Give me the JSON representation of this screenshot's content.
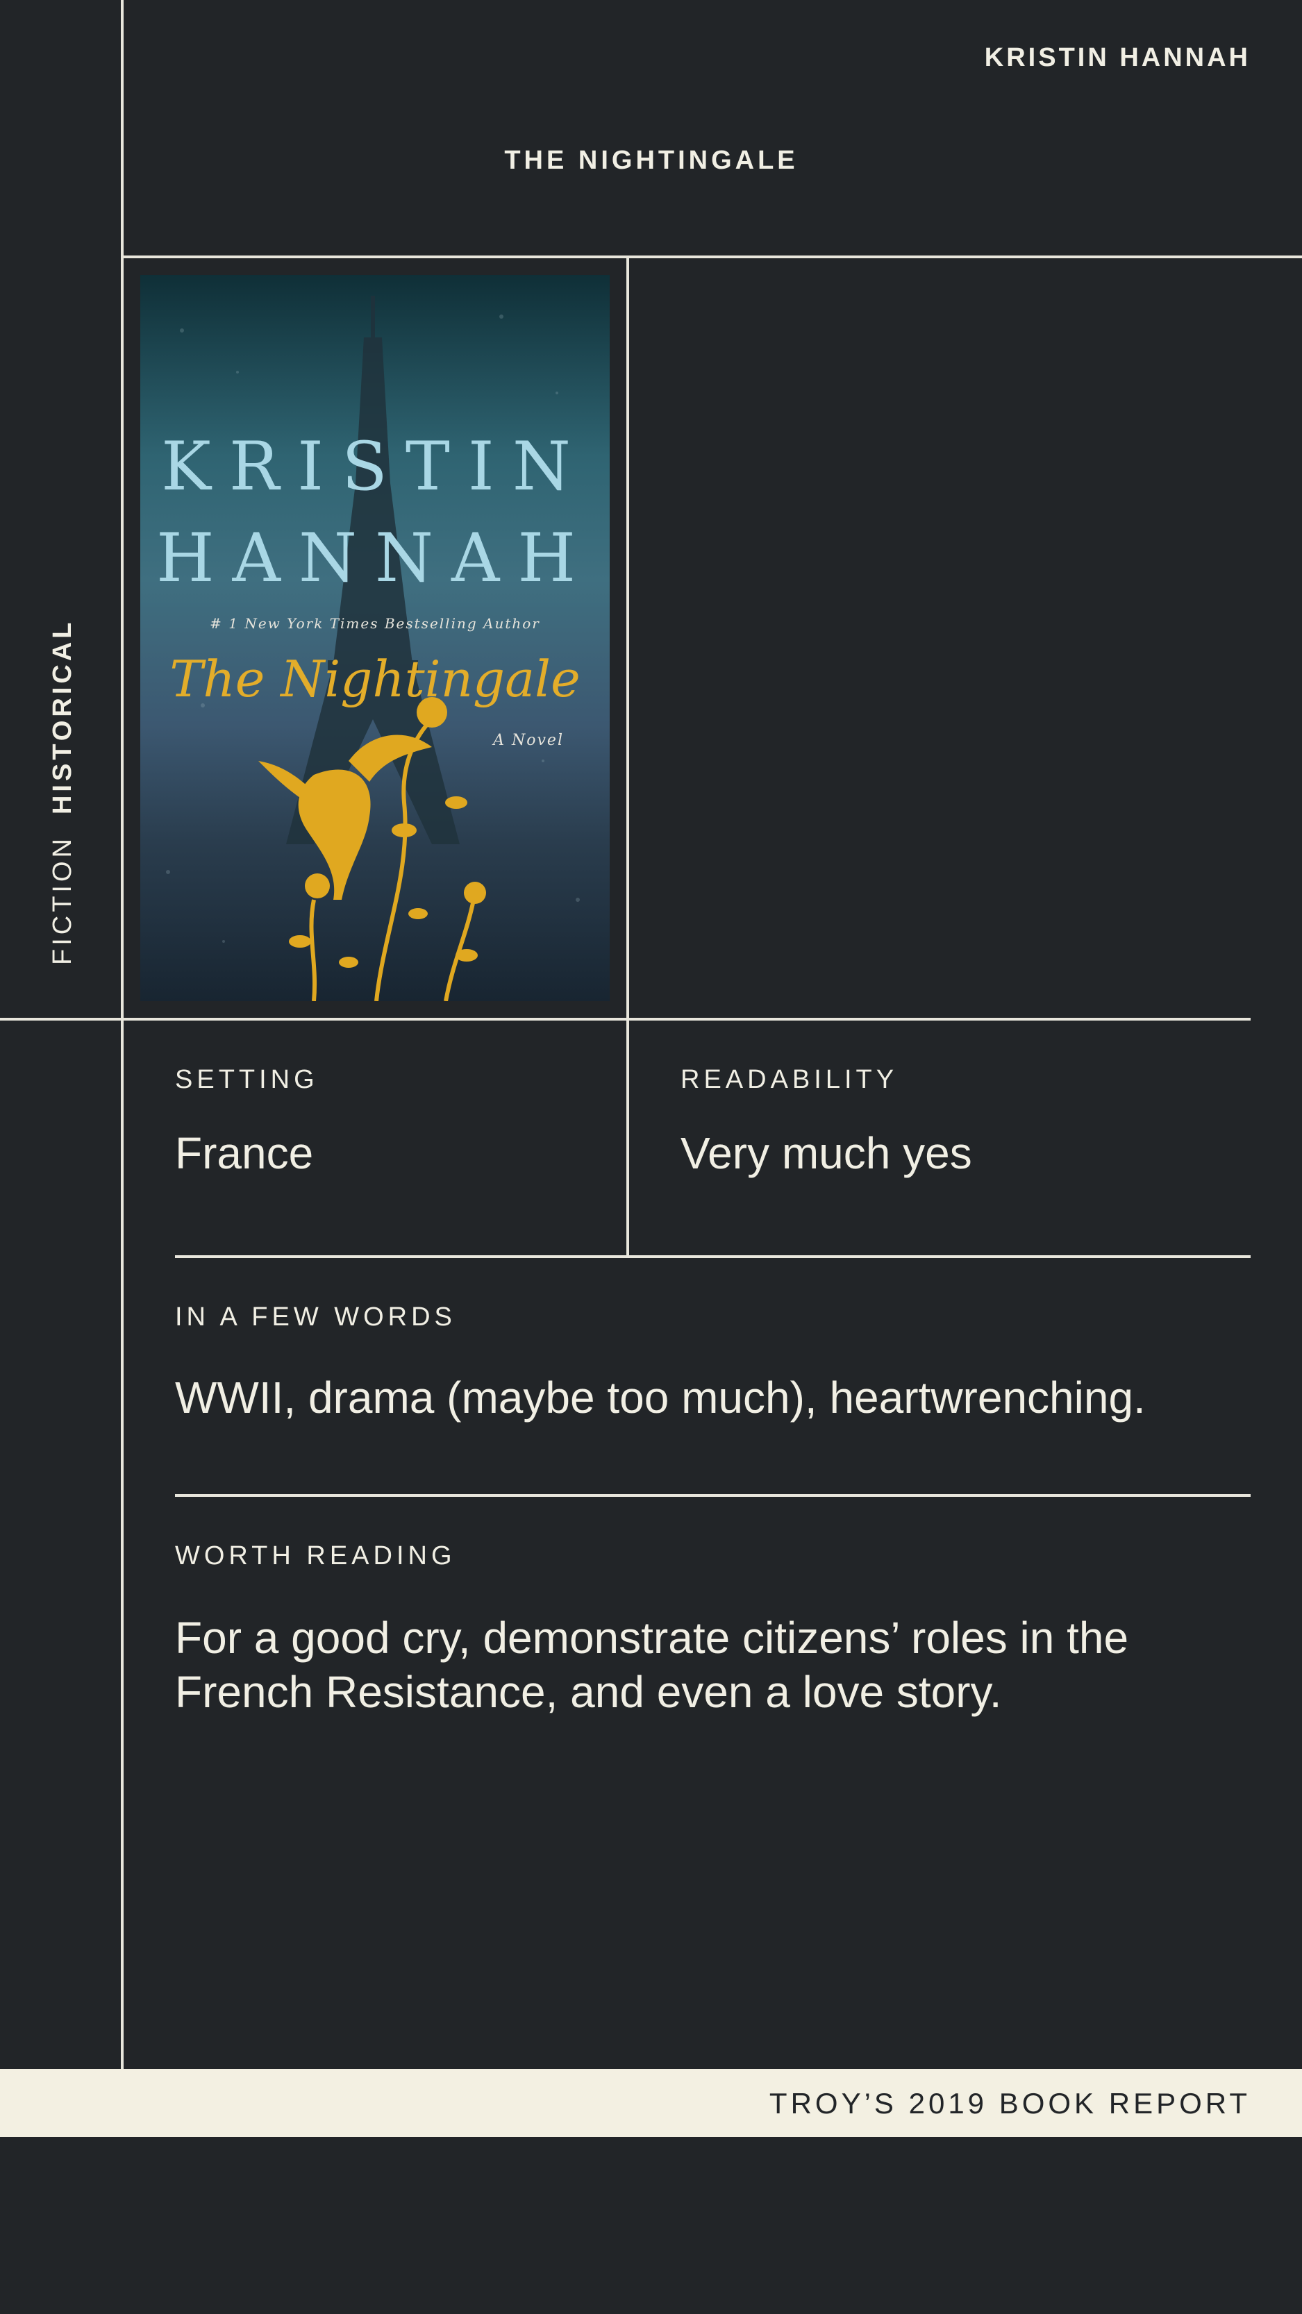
{
  "header": {
    "author": "KRISTIN HANNAH",
    "title": "THE NIGHTINGALE"
  },
  "genre": {
    "primary": "FICTION",
    "secondary": "HISTORICAL"
  },
  "cover": {
    "author_first": "KRISTIN",
    "author_last": "HANNAH",
    "bestselling": "# 1 New York Times Bestselling Author",
    "title": "The Nightingale",
    "subtitle": "A Novel"
  },
  "details": {
    "setting_label": "SETTING",
    "setting_value": "France",
    "readability_label": "READABILITY",
    "readability_value": "Very much yes",
    "few_words_label": "IN A FEW WORDS",
    "few_words_value": "WWII, drama (maybe too much), heartwrenching.",
    "worth_label": "WORTH READING",
    "worth_value": "For a good cry, demonstrate citizens’ roles in the French Resistance, and even a love story."
  },
  "footer": {
    "text": "TROY’S 2019 BOOK REPORT"
  },
  "colors": {
    "background": "#222528",
    "text": "#f1efe4",
    "footer_bg": "#f3f0e2",
    "accent_gold": "#e3ad2a",
    "cover_blue": "#a9d7e5"
  }
}
